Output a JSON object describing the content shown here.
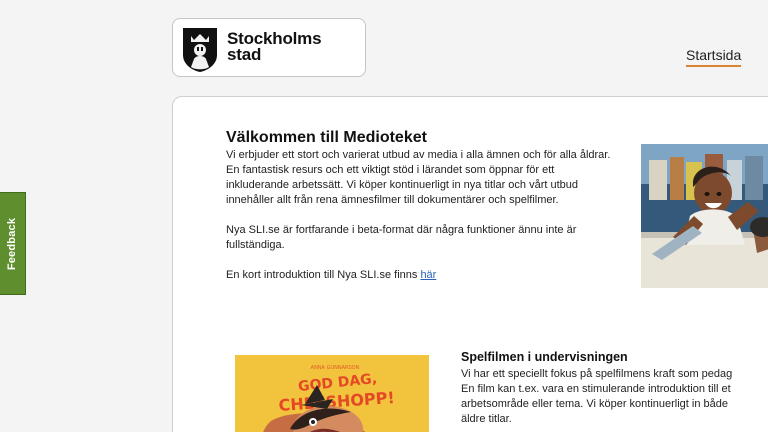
{
  "feedback": {
    "label": "Feedback"
  },
  "header": {
    "logo": {
      "line1": "Stockholms",
      "line2": "stad",
      "icon": "stockholm-crest-icon"
    },
    "nav": {
      "startsida": "Startsida"
    }
  },
  "welcome": {
    "title": "Välkommen till Medioteket",
    "paragraph1": "Vi erbjuder ett stort och varierat utbud av media i alla ämnen och för alla åldrar. En fantastisk resurs och ett viktigt stöd i lärandet som öppnar för ett inkluderande arbetssätt. Vi köper kontinuerligt in nya titlar och vårt utbud innehåller allt från rena ämnesfilmer till dokumentärer och spelfilmer.",
    "paragraph2": "Nya SLI.se är fortfarande i beta-format där några funktioner ännu inte är fullständiga.",
    "paragraph3_text": "En kort introduktion till Nya SLI.se finns ",
    "paragraph3_link": "här"
  },
  "spelfilmen": {
    "title": "Spelfilmen i undervisningen",
    "line1": "Vi har ett speciellt fokus på spelfilmens kraft som pedag",
    "line2": "En film kan t.ex. vara en stimulerande introduktion till et",
    "line3": "arbetsområde eller tema. Vi köper kontinuerligt in både",
    "line4": "äldre titlar."
  },
  "poster": {
    "title_line1": "GOD DAG,",
    "title_line2": "CHEFSHOPP!"
  },
  "colors": {
    "feedback_green": "#5e8e2d",
    "nav_underline": "#d88335",
    "link_blue": "#2a62b8",
    "poster_yellow": "#f4c63a"
  }
}
